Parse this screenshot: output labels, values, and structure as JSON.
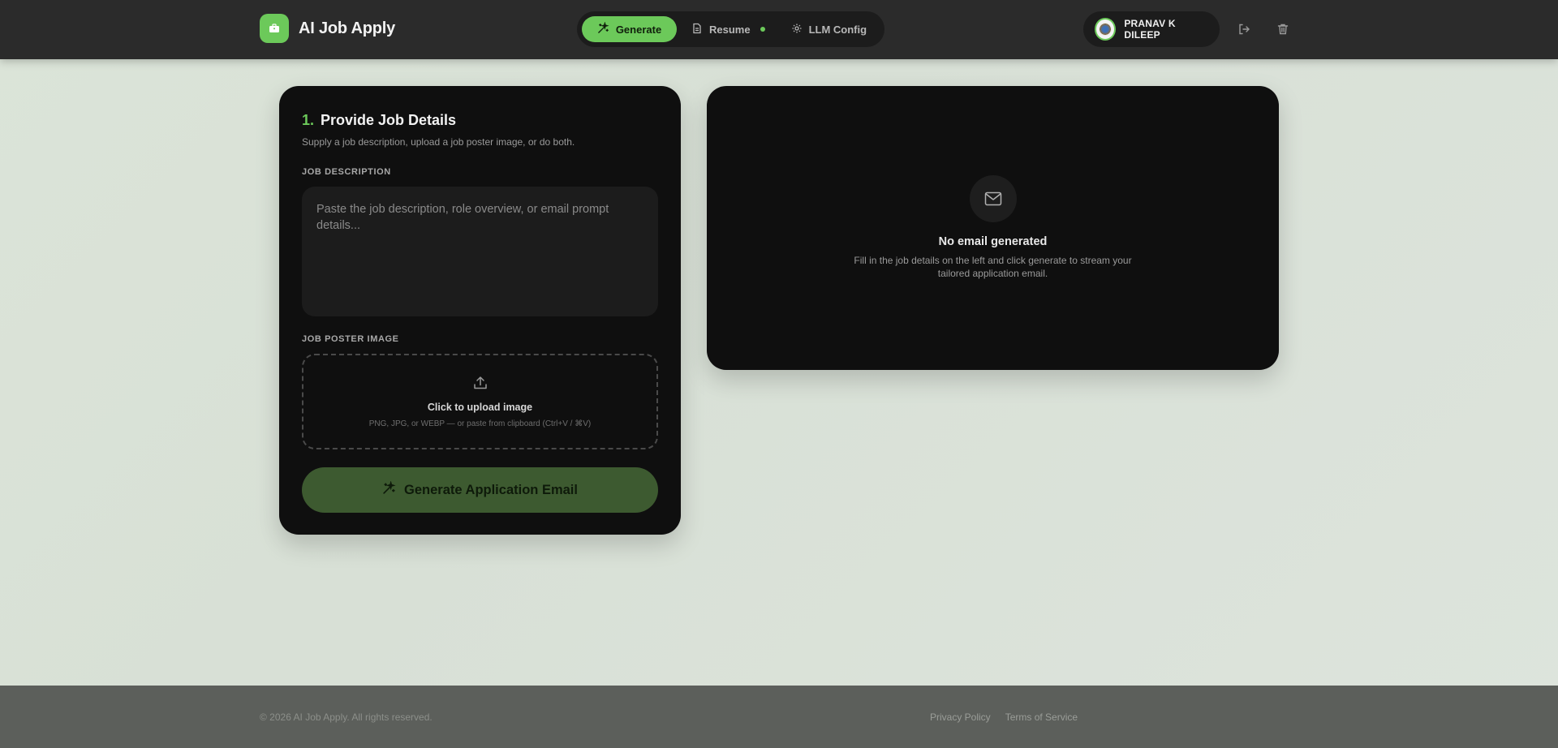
{
  "header": {
    "brand": "AI Job Apply",
    "nav": [
      {
        "label": "Generate",
        "icon": "sparkles-icon",
        "active": true
      },
      {
        "label": "Resume",
        "icon": "document-icon",
        "active": false
      },
      {
        "label": "LLM Config",
        "icon": "gear-icon",
        "active": false
      }
    ],
    "user": {
      "name": "PRANAV K DILEEP"
    }
  },
  "job_details": {
    "step_number": "1.",
    "title": "Provide Job Details",
    "subtitle": "Supply a job description, upload a job poster image, or do both.",
    "description_label": "Job Description",
    "description_placeholder": "Paste the job description, role overview, or email prompt details...",
    "description_value": "",
    "poster_label": "Job Poster Image",
    "upload_title": "Click to upload image",
    "upload_hint": "PNG, JPG, or WEBP — or paste from clipboard (Ctrl+V / ⌘V)",
    "generate_label": "Generate Application Email"
  },
  "output": {
    "empty_title": "No email generated",
    "empty_text": "Fill in the job details on the left and click generate to stream your tailored application email."
  },
  "footer": {
    "copyright": "© 2026 AI Job Apply. All rights reserved.",
    "links": [
      "Privacy Policy",
      "Terms of Service"
    ]
  },
  "colors": {
    "accent": "#6cc95a",
    "card": "#0f0f0f",
    "header": "#2b2b2b",
    "footer": "#5c5f5b"
  }
}
